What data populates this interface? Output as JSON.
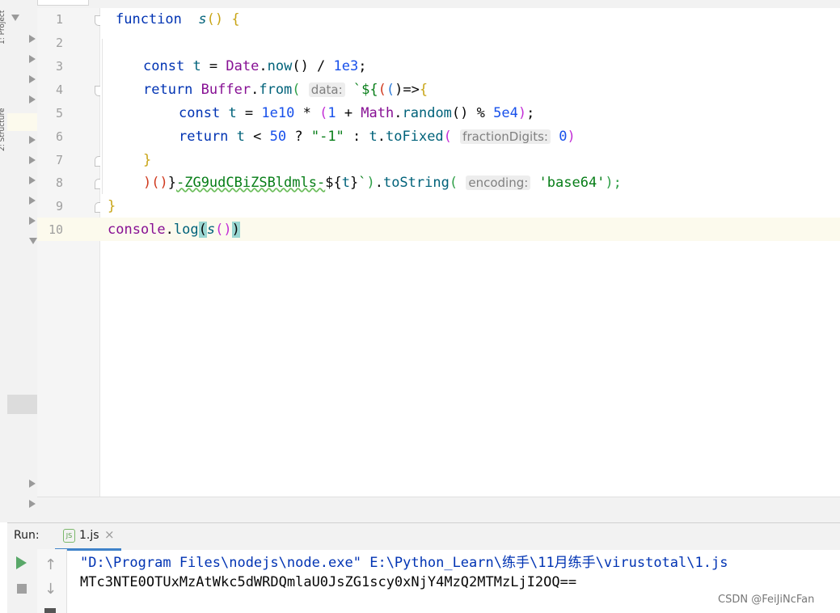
{
  "tool_strip": {
    "label_top": "1: Project",
    "label_mid": "2: Structure"
  },
  "gutter": {
    "line_numbers": [
      "1",
      "2",
      "3",
      "4",
      "5",
      "6",
      "7",
      "8",
      "9",
      "10"
    ]
  },
  "code": {
    "l1": {
      "kw": "function",
      "name": "s",
      "rest": "() {"
    },
    "l3": {
      "kw": "const",
      "var": "t",
      "eq": " = ",
      "cls": "Date",
      "dot": ".",
      "fn": "now",
      "rest": "() / ",
      "num": "1e3",
      "end": ";"
    },
    "l4": {
      "kw": "return",
      "cls": "Buffer",
      "dot": ".",
      "fn": "from",
      "paren": "(",
      "hint": "data:",
      "tick": "`${",
      "a": "(",
      "b": "(",
      "c": ")=>",
      "d": "{"
    },
    "l5": {
      "kw": "const",
      "var": "t",
      "eq": " = ",
      "num1": "1e10",
      "mul": " * ",
      "po": "(",
      "num2": "1",
      "plus": " + ",
      "cls": "Math",
      "dot": ".",
      "fn": "random",
      "mid": "() % ",
      "num3": "5e4",
      "pc": ")",
      "end": ";"
    },
    "l6": {
      "kw": "return",
      "var1": "t",
      "lt": " < ",
      "num1": "50",
      "q": " ? ",
      "str": "\"-1\"",
      "col": " : ",
      "var2": "t",
      "dot": ".",
      "fn": "toFixed",
      "po": "(",
      "hint": "fractionDigits:",
      "num2": "0",
      "pc": ")"
    },
    "l7": {
      "brace": "}"
    },
    "l8": {
      "a": ")",
      "b": "()",
      "c": "}",
      "wav": "-ZG9udCBiZSBldmls-",
      "tpl_open": "${",
      "var": "t",
      "tpl_close": "}",
      "tick": "`",
      "close": ")",
      "dot": ".",
      "fn": "toString",
      "po": "(",
      "hint": "encoding:",
      "str": "'base64'",
      "end": ");"
    },
    "l9": {
      "brace": "}"
    },
    "l10": {
      "obj": "console",
      "dot": ".",
      "fn": "log",
      "po": "(",
      "call": "s",
      "cp": "()",
      "pc": ")"
    }
  },
  "run": {
    "label": "Run:",
    "tab": "1.js",
    "tab_icon": "JS",
    "close": "×",
    "command": "\"D:\\Program Files\\nodejs\\node.exe\" E:\\Python_Learn\\练手\\11月练手\\virustotal\\1.js",
    "output": "MTc3NTE0OTUxMzAtWkc5dWRDQmlaU0JsZG1scy0xNjY4MzQ2MTMzLjI2OQ=="
  },
  "watermark": "CSDN @FeiJiNcFan",
  "icons": {
    "run": "play-icon",
    "stop": "stop-icon",
    "up": "arrow-up-icon",
    "down": "arrow-down-icon"
  }
}
